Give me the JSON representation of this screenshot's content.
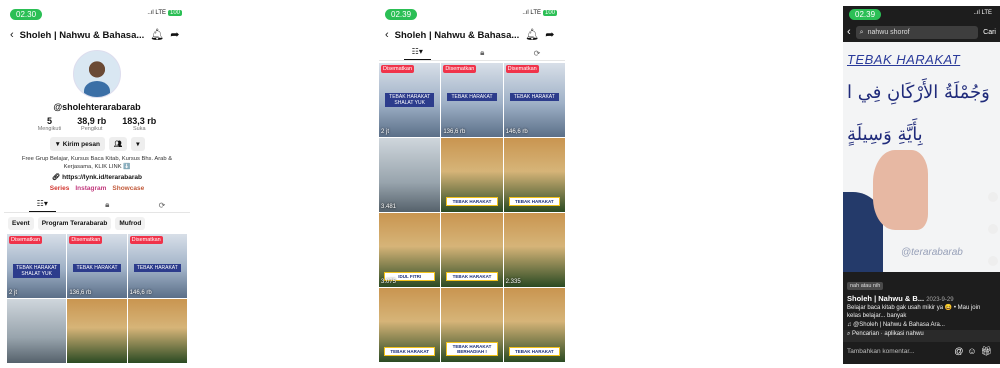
{
  "profile": {
    "status_time": "02.30",
    "signal": "..ıl LTE",
    "battery": "100",
    "title": "Sholeh | Nahwu & Bahasa...",
    "handle": "@sholehterarabarab",
    "stats": [
      {
        "value": "5",
        "label": "Mengikuti"
      },
      {
        "value": "38,9 rb",
        "label": "Pengikut"
      },
      {
        "value": "183,3 rb",
        "label": "Suka"
      }
    ],
    "message_btn": "Kirim pesan",
    "bio": "Free Grup Belajar, Kursus Baca Kitab, Kursus Bhs. Arab & Kerjasama, KLIK LINK ⬇️",
    "link": "https://lynk.id/terarabarab",
    "chips": [
      "Series",
      "Instagram",
      "Showcase"
    ],
    "playlists": [
      "Event",
      "Program Terarabarab",
      "Mufrod"
    ],
    "videos": [
      {
        "pinned": "Disematkan",
        "views": "2 jt",
        "caption": "TEBAK HARAKAT SHALAT YUK"
      },
      {
        "pinned": "Disematkan",
        "views": "136,6 rb",
        "caption": "TEBAK HARAKAT"
      },
      {
        "pinned": "Disematkan",
        "views": "146,6 rb",
        "caption": "TEBAK HARAKAT"
      },
      {
        "pinned": "",
        "views": "",
        "caption": ""
      },
      {
        "pinned": "",
        "views": "",
        "caption": ""
      },
      {
        "pinned": "",
        "views": "",
        "caption": ""
      }
    ]
  },
  "grid": {
    "status_time": "02.39",
    "signal": "..ıl LTE",
    "battery": "100",
    "title": "Sholeh | Nahwu & Bahasa...",
    "videos": [
      {
        "pinned": "Disematkan",
        "views": "2 jt",
        "caption": "TEBAK HARAKAT SHALAT YUK"
      },
      {
        "pinned": "Disematkan",
        "views": "136,6 rb",
        "caption": "TEBAK HARAKAT"
      },
      {
        "pinned": "Disematkan",
        "views": "146,6 rb",
        "caption": "TEBAK HARAKAT"
      },
      {
        "pinned": "",
        "views": "3.481",
        "caption": ""
      },
      {
        "pinned": "",
        "views": "",
        "caption": "TEBAK HARAKAT"
      },
      {
        "pinned": "",
        "views": "",
        "caption": "TEBAK HARAKAT"
      },
      {
        "pinned": "",
        "views": "3.075",
        "caption": "IDUL FITRI"
      },
      {
        "pinned": "",
        "views": "",
        "caption": "TEBAK HARAKAT"
      },
      {
        "pinned": "",
        "views": "2.335",
        "caption": ""
      },
      {
        "pinned": "",
        "views": "",
        "caption": "TEBAK HARAKAT"
      },
      {
        "pinned": "",
        "views": "",
        "caption": "TEBAK HARAKAT BERHADIAH !"
      },
      {
        "pinned": "",
        "views": "",
        "caption": "TEBAK HARAKAT"
      }
    ]
  },
  "player": {
    "status_time": "02.39",
    "signal": "..ıl LTE",
    "search_text": "nahwu shorof",
    "search_btn": "Cari",
    "board_title": "TEBAK HARAKAT",
    "board_arabic_1": "وَجُمْلَةُ الأَرْكَانِ فِي ا",
    "board_arabic_2": "بِأَيَّةِ وَسِيلَةٍ",
    "board_signature": "@terarabarab",
    "badge": "nah atau nih",
    "author": "Sholeh | Nahwu & B...",
    "date": "2023-9-29",
    "desc": "Belajar baca kitab gak usah mikir ya 😄 • Mau join kelas belajar... banyak",
    "music": "♫ @Sholeh | Nahwu & Bahasa Ara...",
    "related": "Pencarian · aplikasi nahwu",
    "comment_placeholder": "Tambahkan komentar..."
  }
}
